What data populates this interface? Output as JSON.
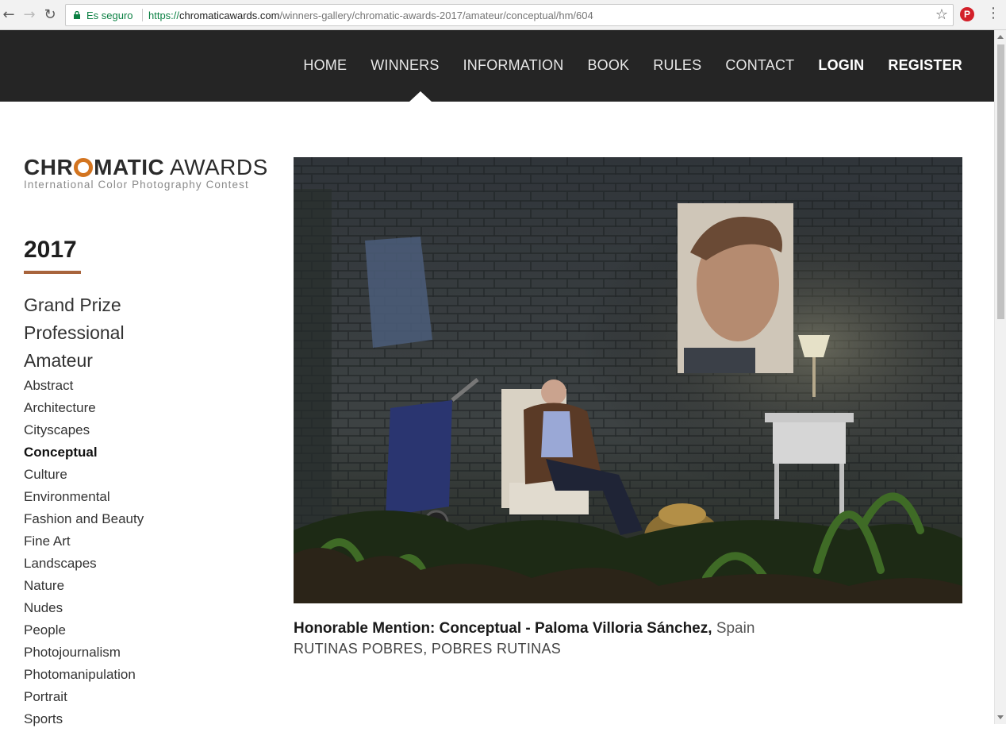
{
  "browser": {
    "secure_label": "Es seguro",
    "url_scheme": "https://",
    "url_host": "chromaticawards.com",
    "url_path": "/winners-gallery/chromatic-awards-2017/amateur/conceptual/hm/604",
    "extension_letter": "P"
  },
  "nav": {
    "items": [
      "HOME",
      "WINNERS",
      "INFORMATION",
      "BOOK",
      "RULES",
      "CONTACT"
    ],
    "login": "LOGIN",
    "register": "REGISTER",
    "active": "WINNERS"
  },
  "logo": {
    "part1": "CHR",
    "part2": "MATIC",
    "part3": "AWARDS",
    "tagline": "International Color Photography Contest"
  },
  "sidebar": {
    "year": "2017",
    "main_categories": [
      "Grand Prize",
      "Professional",
      "Amateur"
    ],
    "categories": [
      "Abstract",
      "Architecture",
      "Cityscapes",
      "Conceptual",
      "Culture",
      "Environmental",
      "Fashion and Beauty",
      "Fine Art",
      "Landscapes",
      "Nature",
      "Nudes",
      "People",
      "Photojournalism",
      "Photomanipulation",
      "Portrait",
      "Sports"
    ],
    "active_category": "Conceptual"
  },
  "entry": {
    "award": "Honorable Mention: Conceptual",
    "separator": " - ",
    "author": "Paloma Villoria Sánchez,",
    "country": "Spain",
    "title": "RUTINAS POBRES, POBRES RUTINAS"
  },
  "colors": {
    "header_bg": "#252525",
    "accent": "#a8643c",
    "logo_orange": "#d3741f"
  }
}
